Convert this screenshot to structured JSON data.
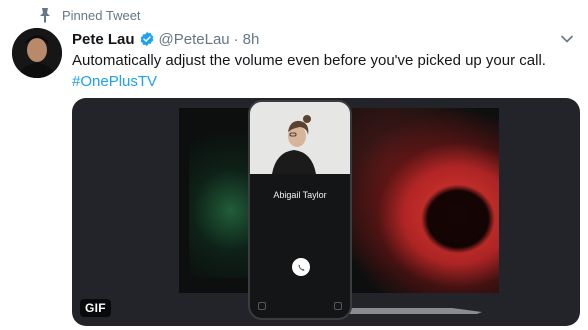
{
  "pinned": {
    "label": "Pinned Tweet",
    "icon": "pin-icon"
  },
  "author": {
    "name": "Pete Lau",
    "handle": "@PeteLau",
    "separator": "·",
    "time": "8h",
    "verified_icon": "verified-badge-icon"
  },
  "tweet": {
    "text": "Automatically adjust the volume even before you've picked up your call.",
    "hashtag": "#OnePlusTV"
  },
  "media": {
    "badge": "GIF",
    "caller_name": "Abigail Taylor"
  },
  "colors": {
    "link": "#1da1f2",
    "secondary_text": "#657786",
    "primary_text": "#14171a",
    "media_bg": "#222429"
  }
}
